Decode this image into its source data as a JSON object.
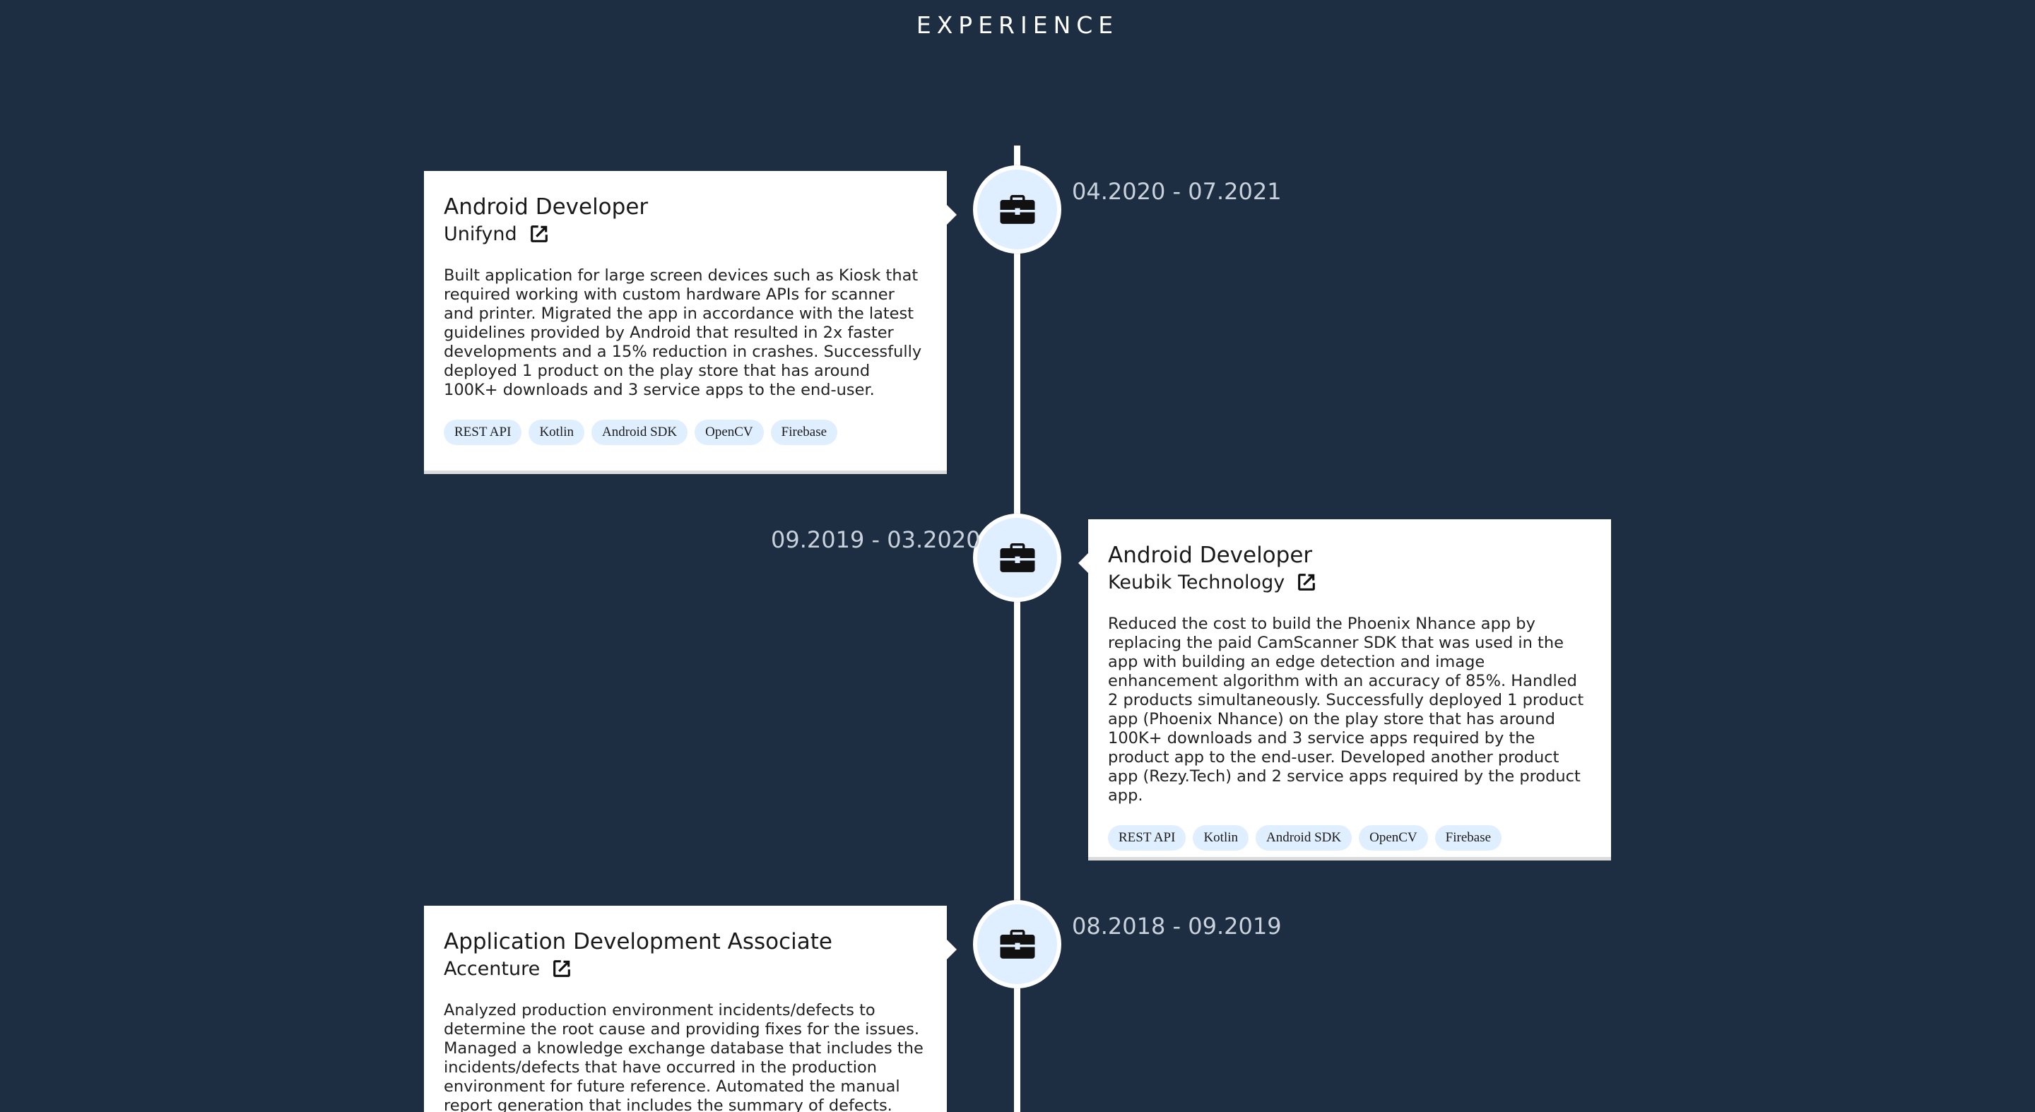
{
  "section": {
    "title": "EXPERIENCE"
  },
  "colors": {
    "background": "#1d2e42",
    "card": "#ffffff",
    "icon_bg": "#e0efff",
    "tag_bg": "#e0efff",
    "date_text": "#c9d2dc"
  },
  "icons": {
    "timeline_marker": "briefcase-icon",
    "company_link": "external-link-icon"
  },
  "experiences": [
    {
      "title": "Android Developer",
      "company": "Unifynd",
      "date": "04.2020 - 07.2021",
      "description": "Built application for large screen devices such as Kiosk that required working with custom hardware APIs for scanner and printer. Migrated the app in accordance with the latest guidelines provided by Android that resulted in 2x faster developments and a 15% reduction in crashes. Successfully deployed 1 product on the play store that has around 100K+ downloads and 3 service apps to the end-user.",
      "tags": [
        "REST API",
        "Kotlin",
        "Android SDK",
        "OpenCV",
        "Firebase"
      ]
    },
    {
      "title": "Android Developer",
      "company": "Keubik Technology",
      "date": "09.2019 - 03.2020",
      "description": "Reduced the cost to build the Phoenix Nhance app by replacing the paid CamScanner SDK that was used in the app with building an edge detection and image enhancement algorithm with an accuracy of 85%. Handled 2 products simultaneously. Successfully deployed 1 product app (Phoenix Nhance) on the play store that has around 100K+ downloads and 3 service apps required by the product app to the end-user. Developed another product app (Rezy.Tech) and 2 service apps required by the product app.",
      "tags": [
        "REST API",
        "Kotlin",
        "Android SDK",
        "OpenCV",
        "Firebase"
      ]
    },
    {
      "title": "Application Development Associate",
      "company": "Accenture",
      "date": "08.2018 - 09.2019",
      "description": "Analyzed production environment incidents/defects to determine the root cause and providing fixes for the issues. Managed a knowledge exchange database that includes the incidents/defects that have occurred in the production environment for future reference. Automated the manual report generation that includes the summary of defects.",
      "tags": []
    }
  ]
}
